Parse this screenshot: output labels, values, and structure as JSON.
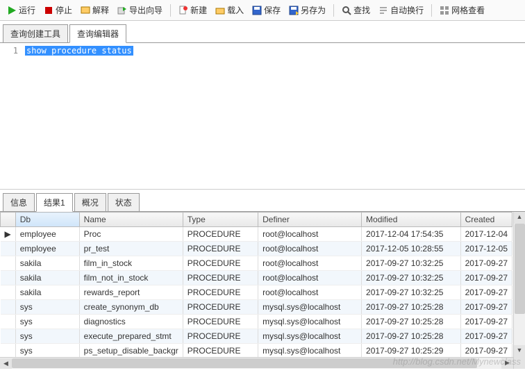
{
  "toolbar": {
    "run": "运行",
    "stop": "停止",
    "explain": "解释",
    "export_wizard": "导出向导",
    "new": "新建",
    "load": "载入",
    "save": "保存",
    "save_as": "另存为",
    "find": "查找",
    "wrap": "自动换行",
    "grid_view": "网格查看"
  },
  "top_tabs": {
    "create_tool": "查询创建工具",
    "editor": "查询编辑器"
  },
  "editor": {
    "line_no": "1",
    "code": "show procedure status"
  },
  "bot_tabs": {
    "info": "信息",
    "result1": "结果1",
    "profile": "概况",
    "status": "状态"
  },
  "grid": {
    "headers": {
      "db": "Db",
      "name": "Name",
      "type": "Type",
      "definer": "Definer",
      "modified": "Modified",
      "created": "Created"
    },
    "rows": [
      {
        "db": "employee",
        "name": "Proc",
        "type": "PROCEDURE",
        "definer": "root@localhost",
        "modified": "2017-12-04 17:54:35",
        "created": "2017-12-04"
      },
      {
        "db": "employee",
        "name": "pr_test",
        "type": "PROCEDURE",
        "definer": "root@localhost",
        "modified": "2017-12-05 10:28:55",
        "created": "2017-12-05"
      },
      {
        "db": "sakila",
        "name": "film_in_stock",
        "type": "PROCEDURE",
        "definer": "root@localhost",
        "modified": "2017-09-27 10:32:25",
        "created": "2017-09-27"
      },
      {
        "db": "sakila",
        "name": "film_not_in_stock",
        "type": "PROCEDURE",
        "definer": "root@localhost",
        "modified": "2017-09-27 10:32:25",
        "created": "2017-09-27"
      },
      {
        "db": "sakila",
        "name": "rewards_report",
        "type": "PROCEDURE",
        "definer": "root@localhost",
        "modified": "2017-09-27 10:32:25",
        "created": "2017-09-27"
      },
      {
        "db": "sys",
        "name": "create_synonym_db",
        "type": "PROCEDURE",
        "definer": "mysql.sys@localhost",
        "modified": "2017-09-27 10:25:28",
        "created": "2017-09-27"
      },
      {
        "db": "sys",
        "name": "diagnostics",
        "type": "PROCEDURE",
        "definer": "mysql.sys@localhost",
        "modified": "2017-09-27 10:25:28",
        "created": "2017-09-27"
      },
      {
        "db": "sys",
        "name": "execute_prepared_stmt",
        "type": "PROCEDURE",
        "definer": "mysql.sys@localhost",
        "modified": "2017-09-27 10:25:28",
        "created": "2017-09-27"
      },
      {
        "db": "sys",
        "name": "ps_setup_disable_backgr",
        "type": "PROCEDURE",
        "definer": "mysql.sys@localhost",
        "modified": "2017-09-27 10:25:29",
        "created": "2017-09-27"
      }
    ]
  },
  "watermark": "http://blog.csdn.net/Mynewclass"
}
